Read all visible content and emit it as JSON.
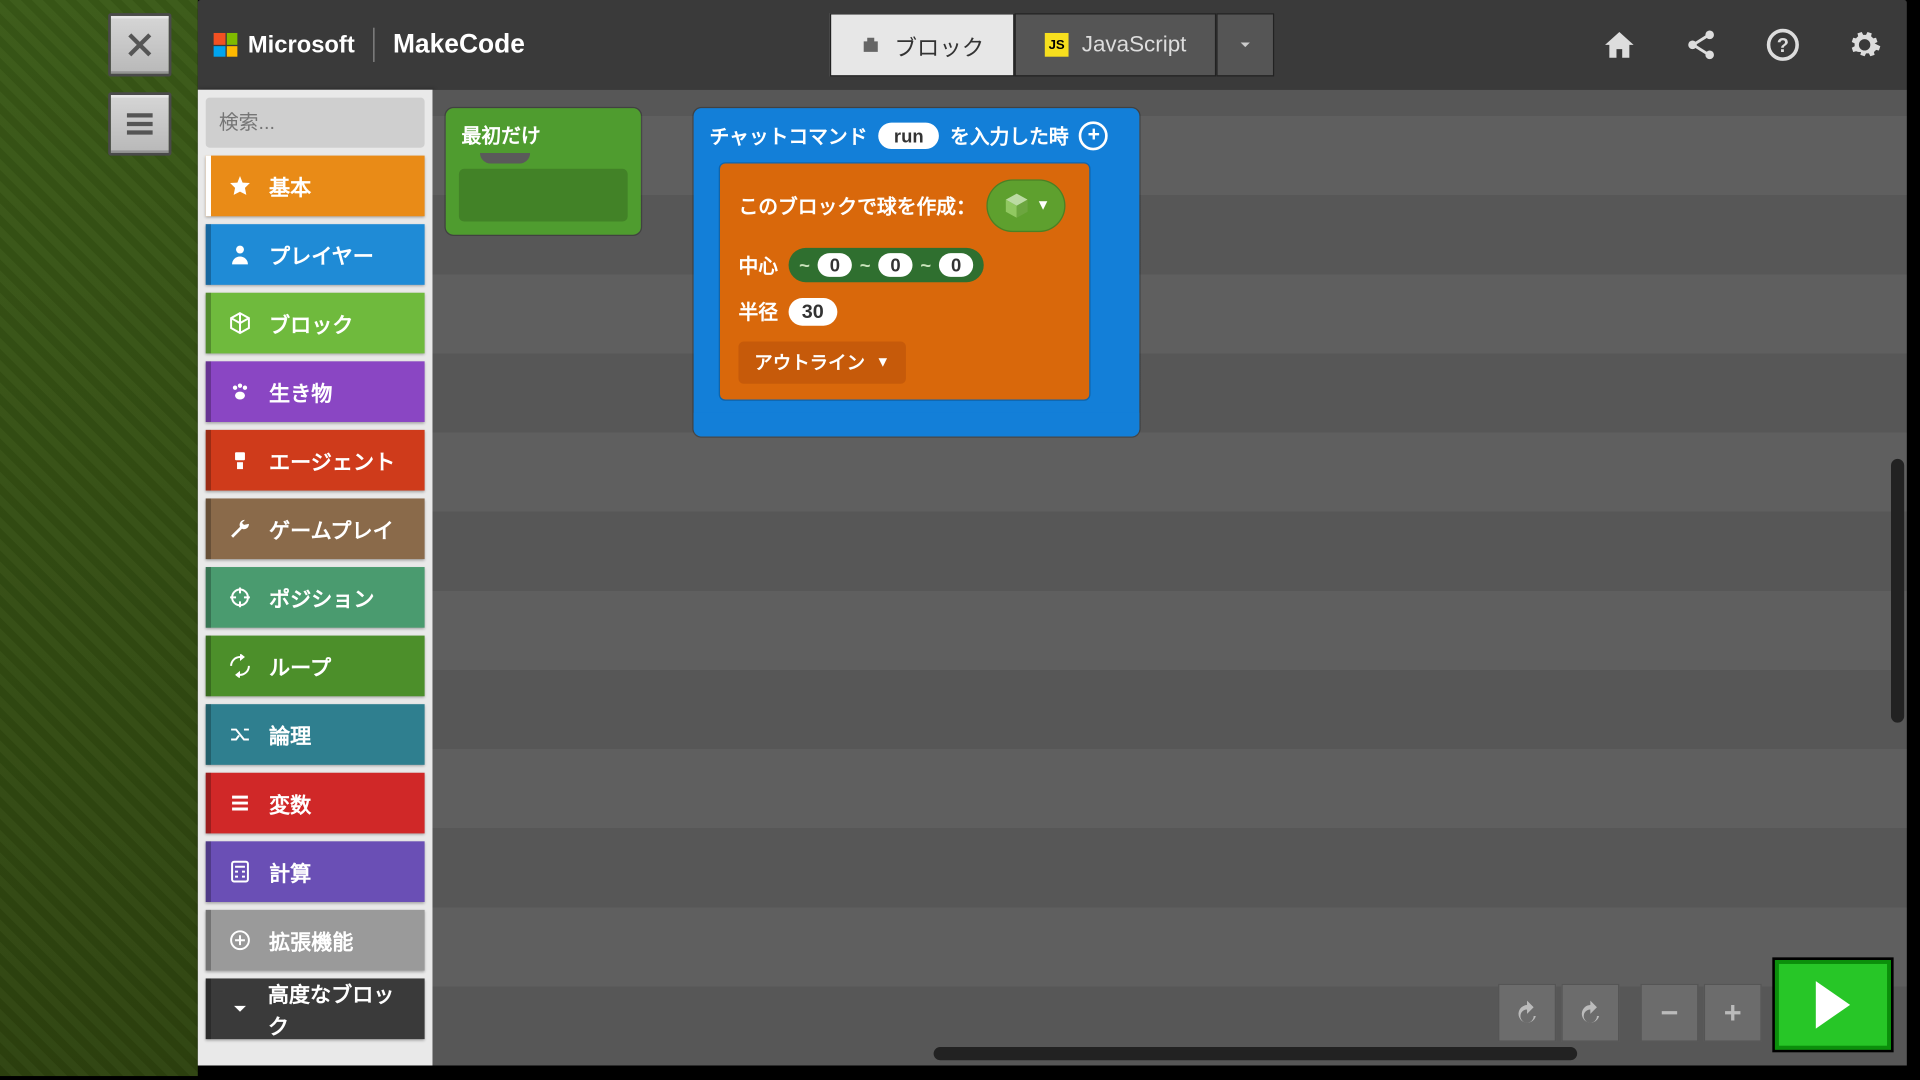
{
  "header": {
    "microsoft": "Microsoft",
    "product": "MakeCode",
    "tab_blocks": "ブロック",
    "tab_js": "JavaScript"
  },
  "search": {
    "placeholder": "検索..."
  },
  "categories": [
    {
      "label": "基本",
      "color": "#e98b17",
      "icon": "star",
      "active": true
    },
    {
      "label": "プレイヤー",
      "color": "#1f8bd6",
      "icon": "person",
      "active": false
    },
    {
      "label": "ブロック",
      "color": "#6fba3d",
      "icon": "cube",
      "active": false
    },
    {
      "label": "生き物",
      "color": "#8a46c3",
      "icon": "paw",
      "active": false
    },
    {
      "label": "エージェント",
      "color": "#cf3b1b",
      "icon": "agent",
      "active": false
    },
    {
      "label": "ゲームプレイ",
      "color": "#8a6a4a",
      "icon": "wrench",
      "active": false
    },
    {
      "label": "ポジション",
      "color": "#4a9b6f",
      "icon": "target",
      "active": false
    },
    {
      "label": "ループ",
      "color": "#4c8f2a",
      "icon": "loop",
      "active": false
    },
    {
      "label": "論理",
      "color": "#2f7f8f",
      "icon": "shuffle",
      "active": false
    },
    {
      "label": "変数",
      "color": "#d02828",
      "icon": "lines",
      "active": false
    },
    {
      "label": "計算",
      "color": "#6a4fb5",
      "icon": "calc",
      "active": false
    },
    {
      "label": "拡張機能",
      "color": "#9a9a9a",
      "icon": "plus",
      "active": false
    },
    {
      "label": "高度なブロック",
      "color": "#3a3a3a",
      "icon": "chevdown",
      "active": false
    }
  ],
  "blocks": {
    "onstart_label": "最初だけ",
    "chat": {
      "prefix": "チャットコマンド",
      "cmd": "run",
      "suffix": "を入力した時"
    },
    "sphere": {
      "title": "このブロックで球を作成：",
      "center_label": "中心",
      "coords": {
        "x": "0",
        "y": "0",
        "z": "0",
        "rel": "~"
      },
      "radius_label": "半径",
      "radius": "30",
      "outline_label": "アウトライン"
    }
  }
}
